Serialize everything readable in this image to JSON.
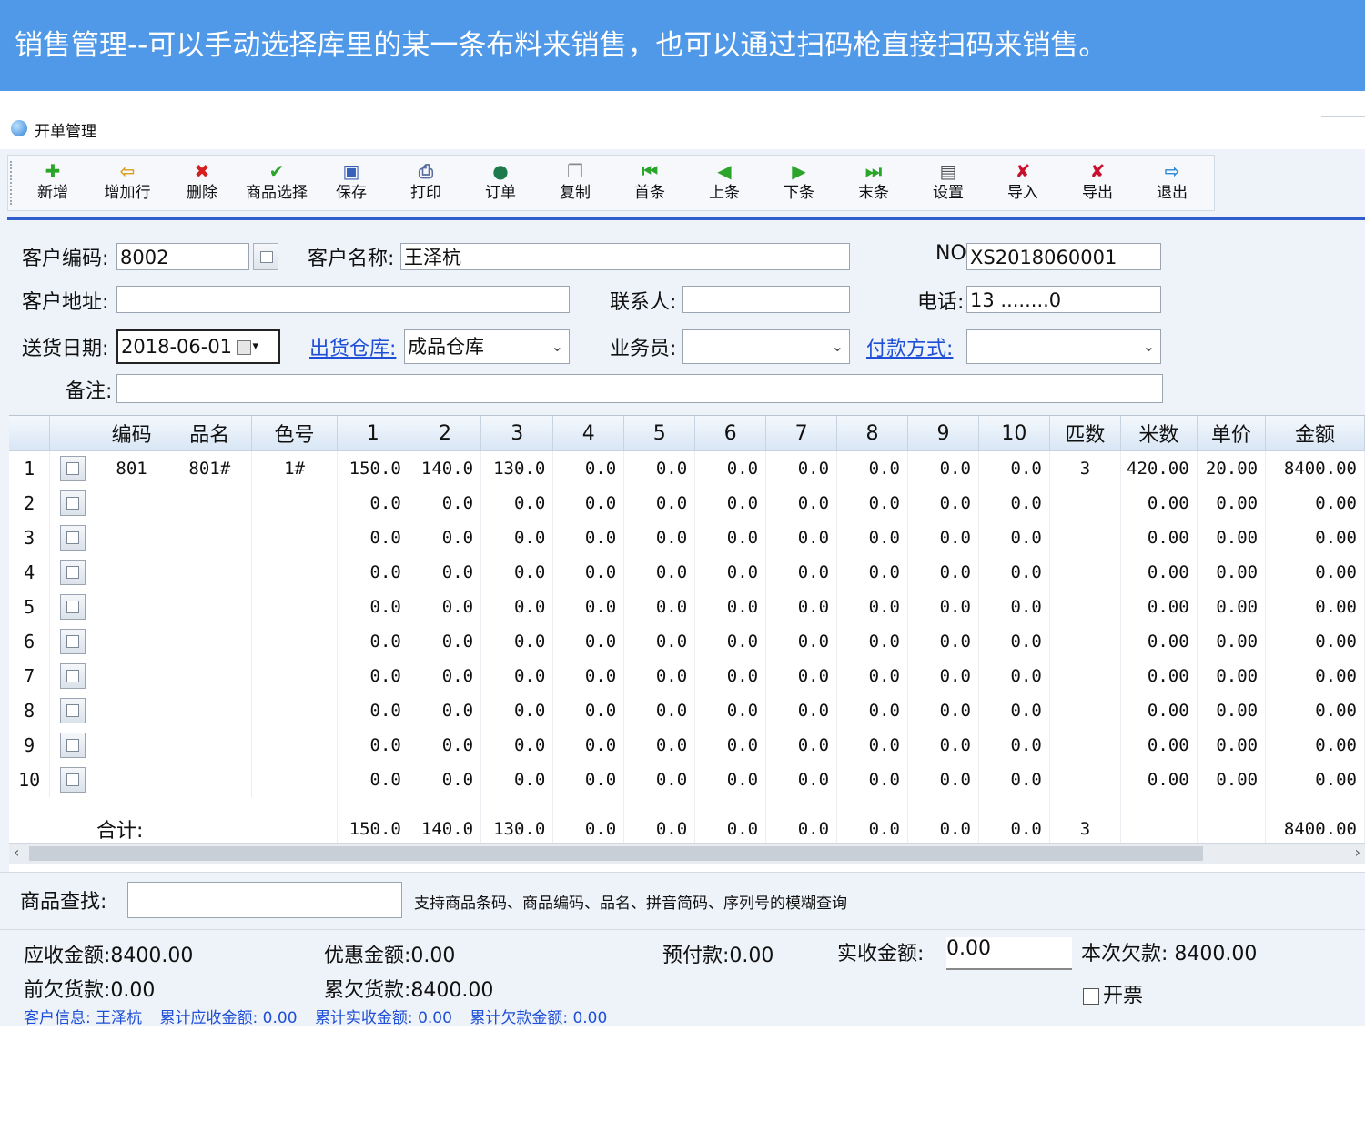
{
  "banner": {
    "text": "销售管理--可以手动选择库里的某一条布料来销售，也可以通过扫码枪直接扫码来销售。"
  },
  "window": {
    "title": "开单管理"
  },
  "toolbar": [
    {
      "label": "新增",
      "icon": "plus-icon",
      "glyph": "✚",
      "color": "#2aa52a"
    },
    {
      "label": "增加行",
      "icon": "add-row-icon",
      "glyph": "⇦",
      "color": "#d9a020"
    },
    {
      "label": "删除",
      "icon": "delete-icon",
      "glyph": "✖",
      "color": "#d42020"
    },
    {
      "label": "商品选择",
      "icon": "check-icon",
      "glyph": "✔",
      "color": "#2aa52a"
    },
    {
      "label": "保存",
      "icon": "save-icon",
      "glyph": "▣",
      "color": "#3a5fb8"
    },
    {
      "label": "打印",
      "icon": "print-icon",
      "glyph": "⎙",
      "color": "#5a6fa0"
    },
    {
      "label": "订单",
      "icon": "order-icon",
      "glyph": "●",
      "color": "#1e7a4a"
    },
    {
      "label": "复制",
      "icon": "copy-icon",
      "glyph": "❐",
      "color": "#8a8a8a"
    },
    {
      "label": "首条",
      "icon": "first-record-icon",
      "glyph": "⏮",
      "color": "#2aa52a"
    },
    {
      "label": "上条",
      "icon": "previous-record-icon",
      "glyph": "◀",
      "color": "#2aa52a"
    },
    {
      "label": "下条",
      "icon": "next-record-icon",
      "glyph": "▶",
      "color": "#2aa52a"
    },
    {
      "label": "末条",
      "icon": "last-record-icon",
      "glyph": "⏭",
      "color": "#2aa52a"
    },
    {
      "label": "设置",
      "icon": "settings-icon",
      "glyph": "▤",
      "color": "#555555"
    },
    {
      "label": "导入",
      "icon": "import-icon",
      "glyph": "✘",
      "color": "#c8102e"
    },
    {
      "label": "导出",
      "icon": "export-icon",
      "glyph": "✘",
      "color": "#c8102e"
    },
    {
      "label": "退出",
      "icon": "exit-icon",
      "glyph": "⇨",
      "color": "#2a8ad4"
    }
  ],
  "form": {
    "customer_code_label": "客户编码:",
    "customer_code": "8002",
    "customer_name_label": "客户名称:",
    "customer_name": "王泽杭",
    "no_label": "NO:",
    "no_value": "XS2018060001",
    "address_label": "客户地址:",
    "address": "",
    "contact_label": "联系人:",
    "contact": "",
    "phone_label": "电话:",
    "phone": "13 ........0",
    "delivery_date_label": "送货日期:",
    "delivery_date": "2018-06-01",
    "warehouse_label": "出货仓库:",
    "warehouse": "成品仓库",
    "salesperson_label": "业务员:",
    "salesperson": "",
    "payment_label": "付款方式:",
    "payment": "",
    "remark_label": "备注:",
    "remark": ""
  },
  "grid": {
    "headers": [
      "",
      "",
      "编码",
      "品名",
      "色号",
      "1",
      "2",
      "3",
      "4",
      "5",
      "6",
      "7",
      "8",
      "9",
      "10",
      "匹数",
      "米数",
      "单价",
      "金额"
    ],
    "rows": [
      [
        "1",
        "801",
        "801#",
        "1#",
        "150.0",
        "140.0",
        "130.0",
        "0.0",
        "0.0",
        "0.0",
        "0.0",
        "0.0",
        "0.0",
        "0.0",
        "3",
        "420.00",
        "20.00",
        "8400.00"
      ],
      [
        "2",
        "",
        "",
        "",
        "0.0",
        "0.0",
        "0.0",
        "0.0",
        "0.0",
        "0.0",
        "0.0",
        "0.0",
        "0.0",
        "0.0",
        "",
        "0.00",
        "0.00",
        "0.00"
      ],
      [
        "3",
        "",
        "",
        "",
        "0.0",
        "0.0",
        "0.0",
        "0.0",
        "0.0",
        "0.0",
        "0.0",
        "0.0",
        "0.0",
        "0.0",
        "",
        "0.00",
        "0.00",
        "0.00"
      ],
      [
        "4",
        "",
        "",
        "",
        "0.0",
        "0.0",
        "0.0",
        "0.0",
        "0.0",
        "0.0",
        "0.0",
        "0.0",
        "0.0",
        "0.0",
        "",
        "0.00",
        "0.00",
        "0.00"
      ],
      [
        "5",
        "",
        "",
        "",
        "0.0",
        "0.0",
        "0.0",
        "0.0",
        "0.0",
        "0.0",
        "0.0",
        "0.0",
        "0.0",
        "0.0",
        "",
        "0.00",
        "0.00",
        "0.00"
      ],
      [
        "6",
        "",
        "",
        "",
        "0.0",
        "0.0",
        "0.0",
        "0.0",
        "0.0",
        "0.0",
        "0.0",
        "0.0",
        "0.0",
        "0.0",
        "",
        "0.00",
        "0.00",
        "0.00"
      ],
      [
        "7",
        "",
        "",
        "",
        "0.0",
        "0.0",
        "0.0",
        "0.0",
        "0.0",
        "0.0",
        "0.0",
        "0.0",
        "0.0",
        "0.0",
        "",
        "0.00",
        "0.00",
        "0.00"
      ],
      [
        "8",
        "",
        "",
        "",
        "0.0",
        "0.0",
        "0.0",
        "0.0",
        "0.0",
        "0.0",
        "0.0",
        "0.0",
        "0.0",
        "0.0",
        "",
        "0.00",
        "0.00",
        "0.00"
      ],
      [
        "9",
        "",
        "",
        "",
        "0.0",
        "0.0",
        "0.0",
        "0.0",
        "0.0",
        "0.0",
        "0.0",
        "0.0",
        "0.0",
        "0.0",
        "",
        "0.00",
        "0.00",
        "0.00"
      ],
      [
        "10",
        "",
        "",
        "",
        "0.0",
        "0.0",
        "0.0",
        "0.0",
        "0.0",
        "0.0",
        "0.0",
        "0.0",
        "0.0",
        "0.0",
        "",
        "0.00",
        "0.00",
        "0.00"
      ]
    ],
    "total_label": "合计:",
    "totals": [
      "150.0",
      "140.0",
      "130.0",
      "0.0",
      "0.0",
      "0.0",
      "0.0",
      "0.0",
      "0.0",
      "0.0",
      "3",
      "",
      "",
      "8400.00"
    ]
  },
  "search": {
    "label": "商品查找:",
    "value": "",
    "hint": "支持商品条码、商品编码、品名、拼音简码、序列号的模糊查询"
  },
  "summary": {
    "receivable": "应收金额:8400.00",
    "discount": "优惠金额:0.00",
    "prepaid": "预付款:0.00",
    "actual_label": "实收金额:",
    "actual_value": "0.00",
    "current_debt": "本次欠款: 8400.00",
    "previous_debt": "前欠货款:0.00",
    "cumulative_debt": "累欠货款:8400.00",
    "invoice_label": "开票",
    "invoice_checked": false
  },
  "info_bar": {
    "customer": "客户信息: 王泽杭",
    "total_receivable": "累计应收金额: 0.00",
    "total_received": "累计实收金额: 0.00",
    "total_debt": "累计欠款金额: 0.00"
  }
}
